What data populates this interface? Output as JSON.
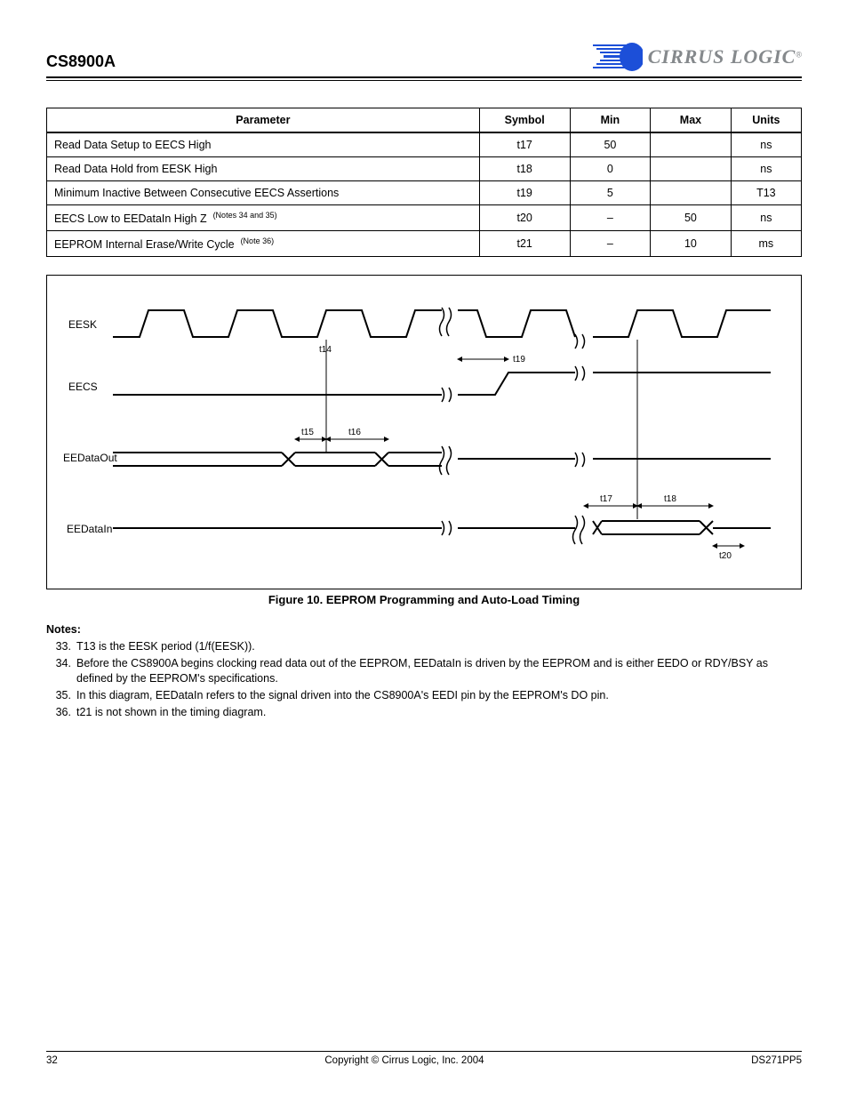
{
  "header": {
    "left": "CS8900A",
    "logo_text": "CIRRUS LOGIC",
    "logo_reg": "®"
  },
  "table": {
    "head": [
      "Parameter",
      "Symbol",
      "Min",
      "Max",
      "Units"
    ],
    "rows": [
      {
        "param": "Read Data Setup to EECS High",
        "sym": "t17",
        "min": "50",
        "max": "",
        "unit": "ns",
        "note": ""
      },
      {
        "param": "Read Data Hold from EESK High",
        "sym": "t18",
        "min": "0",
        "max": "",
        "unit": "ns",
        "note": ""
      },
      {
        "param": "Minimum Inactive Between Consecutive EECS Assertions",
        "sym": "t19",
        "min": "5",
        "max": "",
        "unit": "T13",
        "note": ""
      },
      {
        "param": "EECS Low to EEDataIn High Z",
        "sym": "t20",
        "min": "–",
        "max": "50",
        "unit": "ns",
        "note": "(Notes 34 and 35)"
      },
      {
        "param": "EEPROM Internal Erase/Write Cycle",
        "sym": "t21",
        "min": "–",
        "max": "10",
        "unit": "ms",
        "note": "(Note 36)"
      }
    ]
  },
  "figure": {
    "caption": "Figure 10. EEPROM Programming and Auto-Load Timing",
    "signals": [
      "EESK",
      "EECS",
      "EEDataOut",
      "EEDataIn"
    ],
    "timings": {
      "t14": "t14",
      "t15": "t15",
      "t16": "t16",
      "t17": "t17",
      "t18": "t18",
      "t19": "t19",
      "t20": "t20"
    }
  },
  "notes": {
    "title": "Notes:",
    "items": [
      {
        "n": "33.",
        "txt": "T13 is the EESK period (1/f(EESK))."
      },
      {
        "n": "34.",
        "txt": "Before the CS8900A begins clocking read data out of the EEPROM, EEDataIn is driven by the EEPROM and is either EEDO or RDY/BSY as defined by the EEPROM's specifications."
      },
      {
        "n": "35.",
        "txt": "In this diagram, EEDataIn refers to the signal driven into the CS8900A's EEDI pin by the EEPROM's DO pin."
      },
      {
        "n": "36.",
        "txt": "t21 is not shown in the timing diagram."
      }
    ]
  },
  "footer": {
    "left": "32",
    "center": "Copyright © Cirrus Logic, Inc. 2004",
    "right": "DS271PP5"
  }
}
